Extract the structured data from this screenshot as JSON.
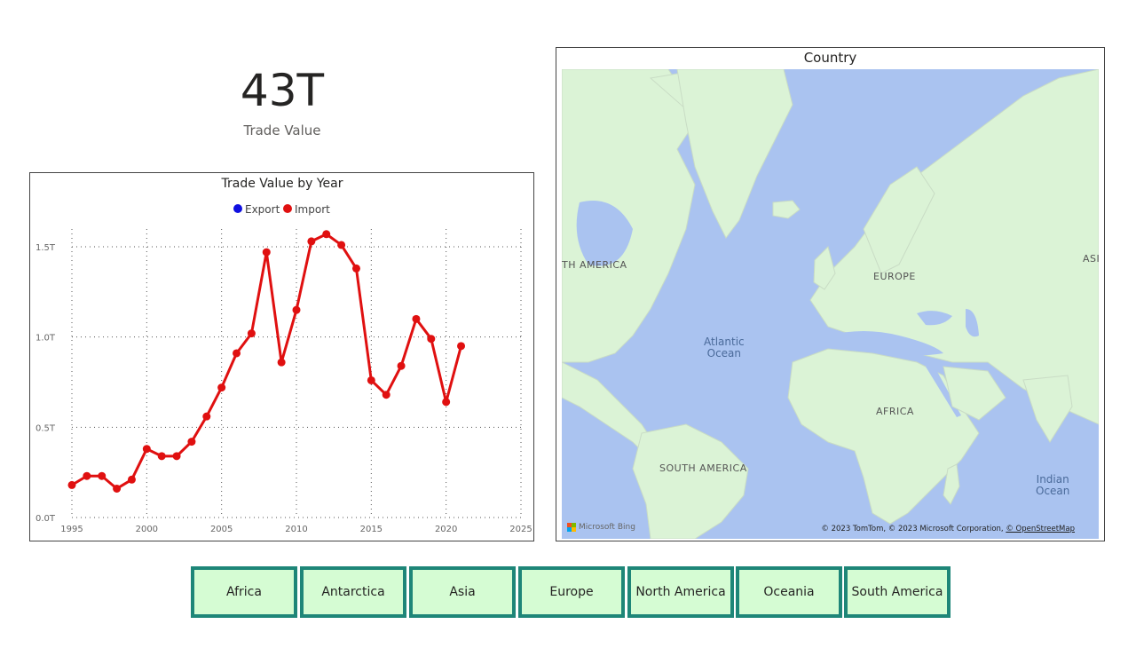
{
  "kpi": {
    "value": "43T",
    "label": "Trade Value"
  },
  "chart_data": {
    "type": "line",
    "title": "Trade Value by Year",
    "legend": [
      "Export",
      "Import"
    ],
    "legend_colors": [
      "#1010e0",
      "#e01010"
    ],
    "legend_position": "top-center",
    "grid": true,
    "xlim": [
      1995,
      2025
    ],
    "ylim": [
      0,
      1.5
    ],
    "x_ticks": [
      "1995",
      "2000",
      "2005",
      "2010",
      "2015",
      "2020",
      "2025"
    ],
    "y_ticks": [
      "0.0T",
      "0.5T",
      "1.0T",
      "1.5T"
    ],
    "x": [
      1995,
      1996,
      1997,
      1998,
      1999,
      2000,
      2001,
      2002,
      2003,
      2004,
      2005,
      2006,
      2007,
      2008,
      2009,
      2010,
      2011,
      2012,
      2013,
      2014,
      2015,
      2016,
      2017,
      2018,
      2019,
      2020,
      2021
    ],
    "series": [
      {
        "name": "Import",
        "color": "#e01010",
        "values": [
          0.18,
          0.23,
          0.23,
          0.16,
          0.21,
          0.38,
          0.34,
          0.34,
          0.42,
          0.56,
          0.72,
          0.91,
          1.02,
          1.47,
          0.86,
          1.15,
          1.53,
          1.57,
          1.51,
          1.38,
          0.76,
          0.68,
          0.84,
          1.1,
          0.99,
          0.64,
          0.95
        ]
      }
    ]
  },
  "map": {
    "title": "Country",
    "labels": {
      "north_america": "TH AMERICA",
      "europe": "EUROPE",
      "asia": "ASI",
      "africa": "AFRICA",
      "south_america": "SOUTH AMERICA",
      "atlantic": "Atlantic\nOcean",
      "indian": "Indian\nOcean"
    },
    "bing": "Microsoft Bing",
    "attribution": "© 2023 TomTom, © 2023 Microsoft Corporation, ",
    "attribution_link": "© OpenStreetMap",
    "land_color": "#dbf3d6",
    "water_color": "#aac3f0"
  },
  "slicer": {
    "border_color": "#1e8678",
    "fill_color": "#d5fcd3",
    "items": [
      "Africa",
      "Antarctica",
      "Asia",
      "Europe",
      "North America",
      "Oceania",
      "South America"
    ]
  }
}
